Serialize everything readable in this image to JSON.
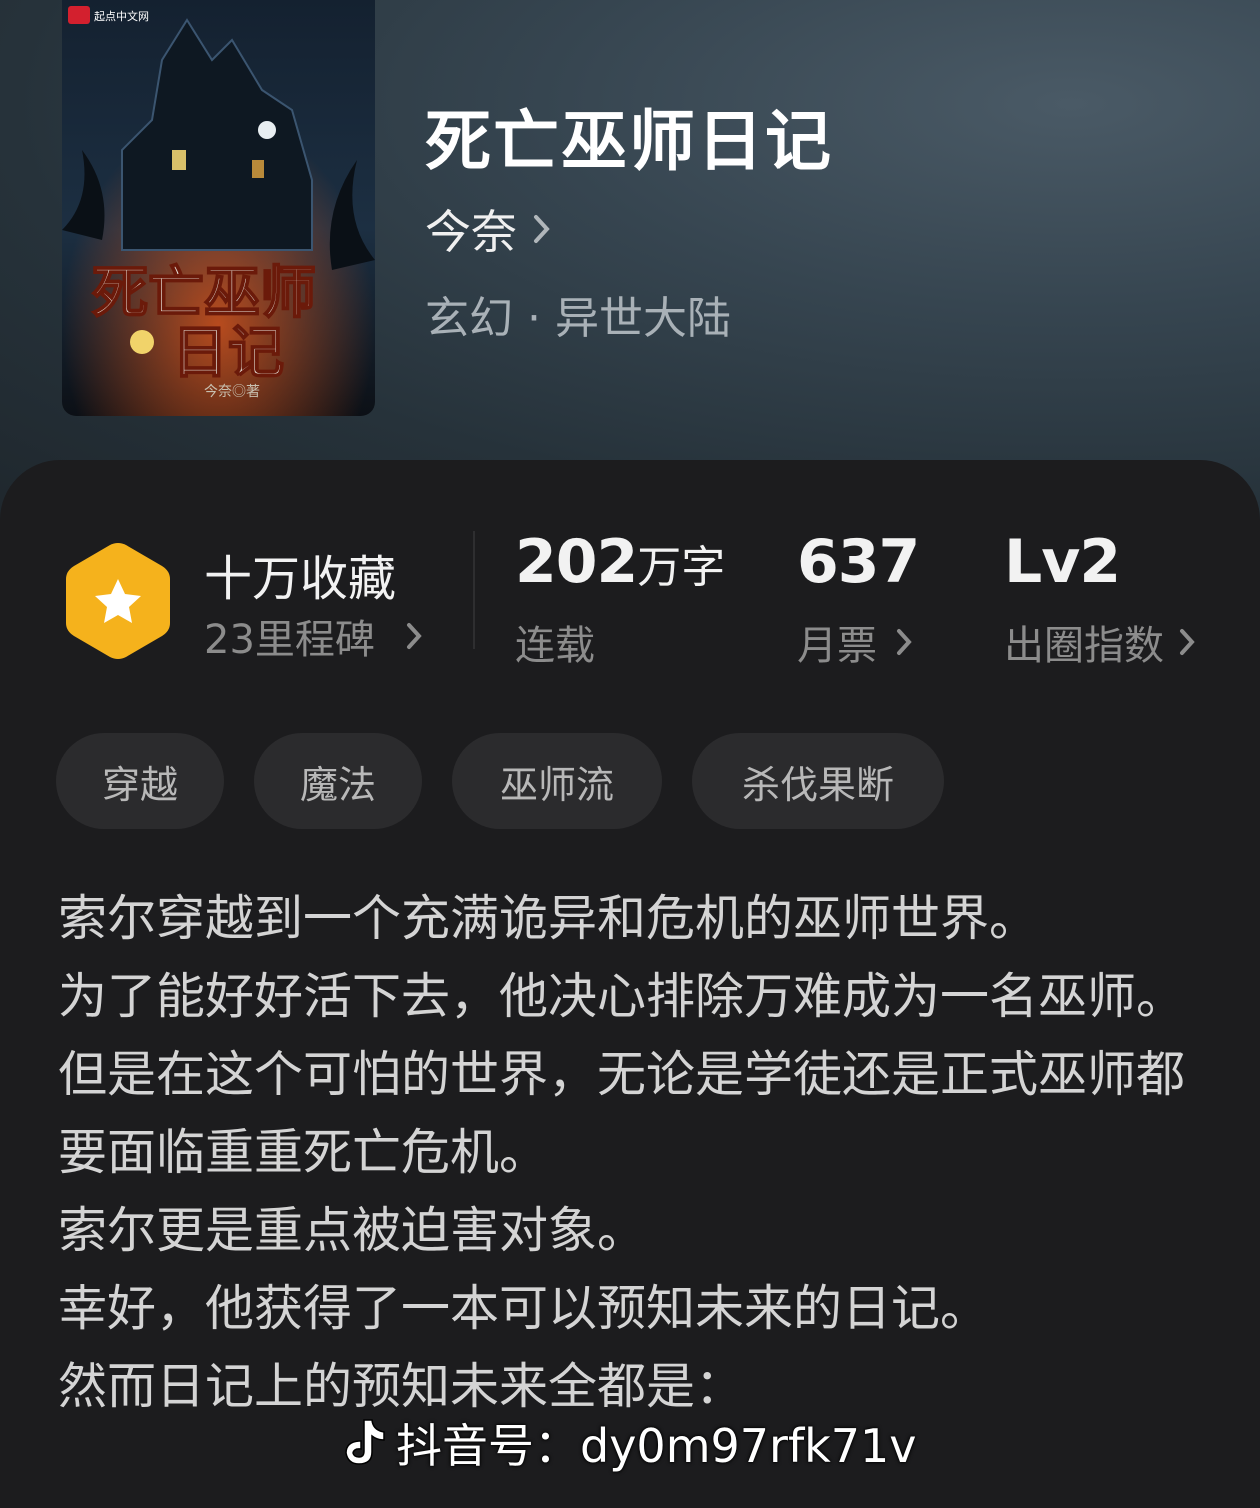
{
  "book": {
    "cover_brand": "起点中文网",
    "cover_title_line1": "死亡巫师",
    "cover_title_line2": "日记",
    "cover_author": "今奈◎著",
    "title": "死亡巫师日记",
    "author": "今奈",
    "genre": "玄幻 · 异世大陆"
  },
  "stats": {
    "collect_title": "十万收藏",
    "collect_sub": "23里程碑",
    "words_num": "202",
    "words_unit": "万字",
    "words_status": "连载",
    "tickets_num": "637",
    "tickets_label": "月票",
    "level_num": "Lv2",
    "level_label": "出圈指数"
  },
  "tags": [
    "穿越",
    "魔法",
    "巫师流",
    "杀伐果断"
  ],
  "description": [
    "索尔穿越到一个充满诡异和危机的巫师世界。",
    "为了能好好活下去，他决心排除万难成为一名巫师。",
    "但是在这个可怕的世界，无论是学徒还是正式巫师都要面临重重死亡危机。",
    "索尔更是重点被迫害对象。",
    "幸好，他获得了一本可以预知未来的日记。",
    "然而日记上的预知未来全都是："
  ],
  "watermark": "抖音号：dy0m97rfk71v",
  "colors": {
    "badge": "#f5b21c",
    "panel": "#1c1c1e",
    "tag_bg": "#2b2b2d"
  },
  "icons": [
    "star-hexagon-badge-icon",
    "chevron-right-icon",
    "douyin-logo-icon"
  ]
}
